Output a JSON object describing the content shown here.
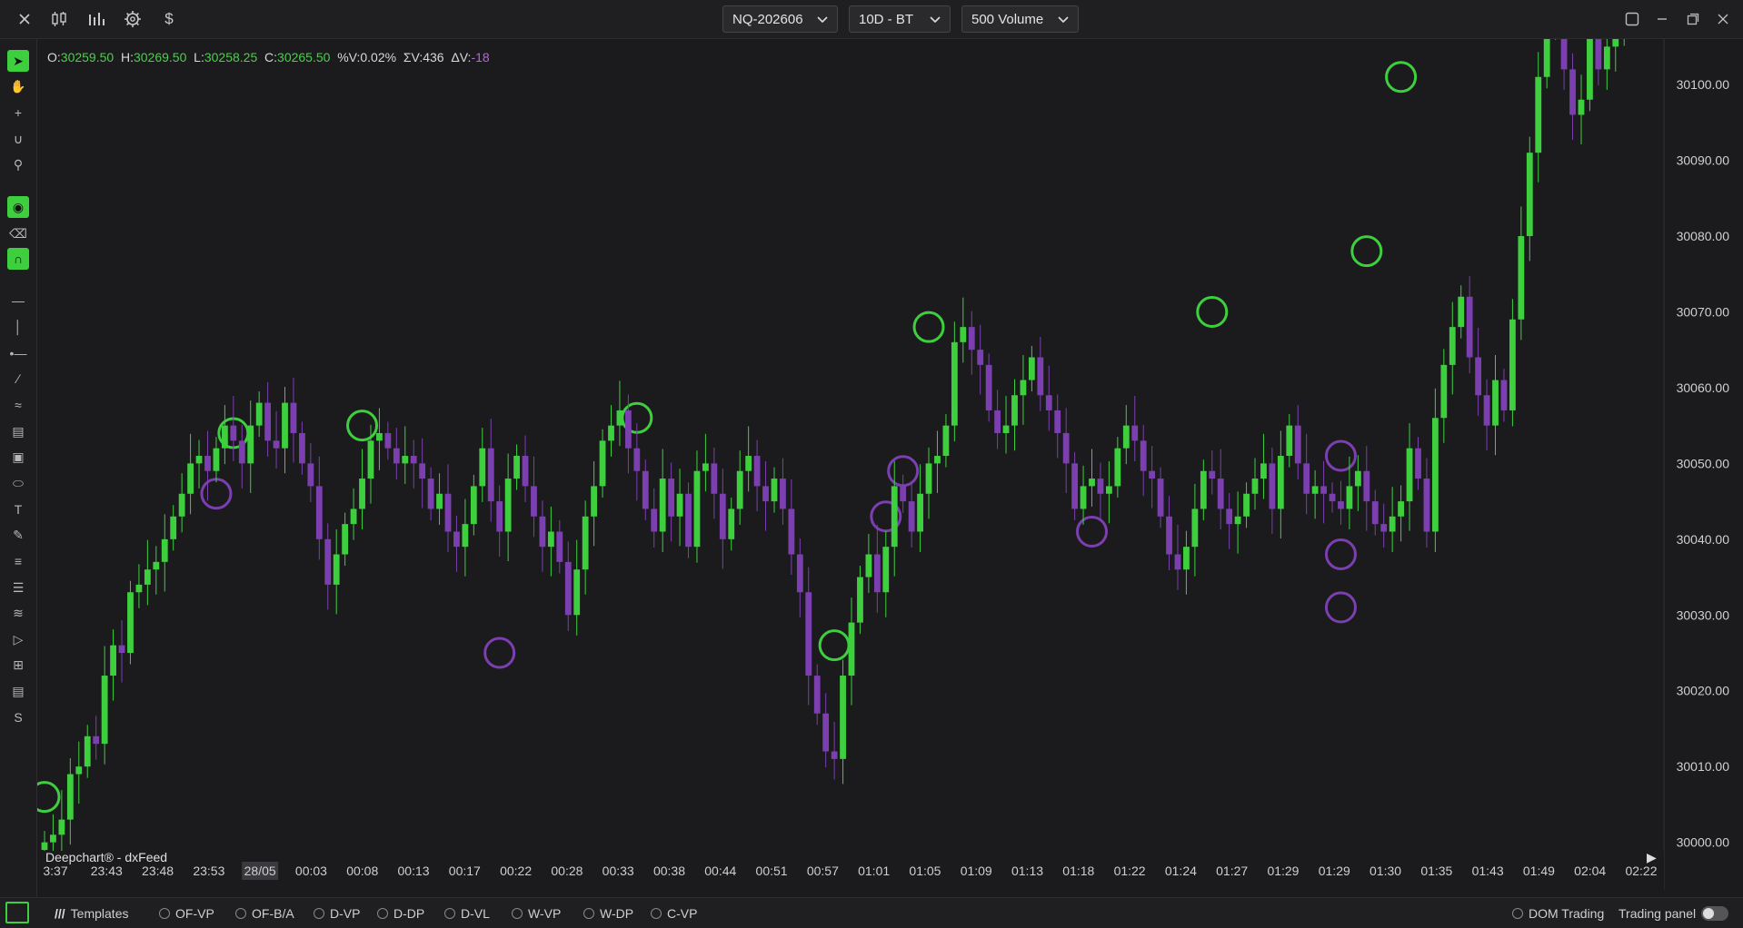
{
  "toolbar": {
    "icons": [
      "close-icon",
      "candlestick-icon",
      "bar-chart-icon",
      "gear-icon",
      "dollar-icon"
    ],
    "symbol": "NQ-202606",
    "timeframe": "10D - BT",
    "bar_type": "500 Volume",
    "window_controls": [
      "restore-layout-icon",
      "minimize-icon",
      "maximize-icon",
      "close-icon"
    ]
  },
  "ohlc": {
    "open_label": "O:",
    "open": "30259.50",
    "high_label": "H:",
    "high": "30269.50",
    "low_label": "L:",
    "low": "30258.25",
    "close_label": "C:",
    "close": "30265.50",
    "pv_label": "%V:",
    "pv": "0.02%",
    "sv_label": "ΣV:",
    "sv": "436",
    "dv_label": "ΔV:",
    "dv": "-18"
  },
  "left_tools": [
    "cursor-icon",
    "hand-icon",
    "crosshair-icon",
    "magnet-cursor-icon",
    "zoom-icon",
    "eye-icon",
    "eraser-icon",
    "magnet-icon",
    "horizontal-line-icon",
    "vertical-line-icon",
    "ray-icon",
    "trend-line-icon",
    "path-icon",
    "ruler-icon",
    "rectangle-icon",
    "ellipse-icon",
    "text-icon",
    "pencil-icon",
    "lines-icon",
    "list-icon",
    "fib-icon",
    "play-tool-icon",
    "settings-lines-icon",
    "dollar-doc-icon",
    "dollar-sign-icon"
  ],
  "watermark": "Deepchart® - dxFeed",
  "colors": {
    "up": "#3ecf3e",
    "down": "#7b3fb0",
    "bg": "#1b1b1d",
    "grid": "#1e1e21"
  },
  "chart_data": {
    "type": "candlestick",
    "title": "",
    "y_ticks": [
      "30100.00",
      "30090.00",
      "30080.00",
      "30070.00",
      "30060.00",
      "30050.00",
      "30040.00",
      "30030.00",
      "30020.00",
      "30010.00",
      "30000.00"
    ],
    "ylim": [
      29999,
      30106
    ],
    "x_ticks": [
      "3:37",
      "23:43",
      "23:48",
      "23:53",
      "28/05",
      "00:03",
      "00:08",
      "00:13",
      "00:17",
      "00:22",
      "00:28",
      "00:33",
      "00:38",
      "00:44",
      "00:51",
      "00:57",
      "01:01",
      "01:05",
      "01:09",
      "01:13",
      "01:18",
      "01:22",
      "01:24",
      "01:27",
      "01:29",
      "01:29",
      "01:30",
      "01:35",
      "01:43",
      "01:49",
      "02:04",
      "02:22"
    ],
    "highlighted_tick": "28/05",
    "closes": [
      30000,
      30001,
      30003,
      30009,
      30010,
      30014,
      30013,
      30022,
      30026,
      30025,
      30033,
      30034,
      30036,
      30037,
      30040,
      30043,
      30046,
      30050,
      30051,
      30049,
      30052,
      30055,
      30053,
      30050,
      30055,
      30058,
      30053,
      30052,
      30058,
      30054,
      30050,
      30047,
      30040,
      30034,
      30038,
      30042,
      30044,
      30048,
      30053,
      30054,
      30052,
      30050,
      30051,
      30050,
      30048,
      30044,
      30046,
      30041,
      30039,
      30042,
      30047,
      30052,
      30045,
      30041,
      30048,
      30051,
      30047,
      30043,
      30039,
      30041,
      30037,
      30030,
      30036,
      30043,
      30047,
      30053,
      30055,
      30057,
      30052,
      30049,
      30044,
      30041,
      30048,
      30043,
      30046,
      30039,
      30049,
      30050,
      30046,
      30040,
      30044,
      30049,
      30051,
      30047,
      30045,
      30048,
      30044,
      30038,
      30033,
      30022,
      30017,
      30012,
      30011,
      30022,
      30029,
      30035,
      30038,
      30033,
      30039,
      30047,
      30045,
      30041,
      30046,
      30050,
      30051,
      30055,
      30066,
      30068,
      30065,
      30063,
      30057,
      30054,
      30055,
      30059,
      30061,
      30064,
      30059,
      30057,
      30054,
      30050,
      30044,
      30047,
      30048,
      30046,
      30047,
      30052,
      30055,
      30053,
      30049,
      30048,
      30043,
      30038,
      30036,
      30039,
      30044,
      30049,
      30048,
      30044,
      30042,
      30043,
      30046,
      30048,
      30050,
      30044,
      30051,
      30055,
      30050,
      30046,
      30047,
      30046,
      30045,
      30044,
      30047,
      30049,
      30045,
      30042,
      30041,
      30043,
      30045,
      30052,
      30048,
      30041,
      30056,
      30063,
      30068,
      30072,
      30064,
      30059,
      30055,
      30061,
      30057,
      30069,
      30080,
      30091,
      30101,
      30108,
      30112,
      30102,
      30096,
      30098,
      30106,
      30102,
      30105,
      30109,
      30110,
      30111,
      30109,
      30110,
      30111
    ],
    "up_markers": [
      [
        0,
        30006
      ],
      [
        22,
        30054
      ],
      [
        37,
        30055
      ],
      [
        69,
        30056
      ],
      [
        92,
        30026
      ],
      [
        103,
        30068
      ],
      [
        136,
        30070
      ],
      [
        154,
        30078
      ],
      [
        158,
        30101
      ]
    ],
    "down_markers": [
      [
        20,
        30046
      ],
      [
        53,
        30025
      ],
      [
        98,
        30043
      ],
      [
        100,
        30049
      ],
      [
        122,
        30041
      ],
      [
        151,
        30051
      ],
      [
        151,
        30038
      ],
      [
        151,
        30031
      ]
    ],
    "grid": false
  },
  "bottom": {
    "templates_label": "Templates",
    "studies": [
      "OF-VP",
      "OF-B/A",
      "D-VP",
      "D-DP",
      "D-VL",
      "W-VP",
      "W-DP",
      "C-VP"
    ],
    "dom_trading": "DOM Trading",
    "trading_panel": "Trading panel"
  }
}
